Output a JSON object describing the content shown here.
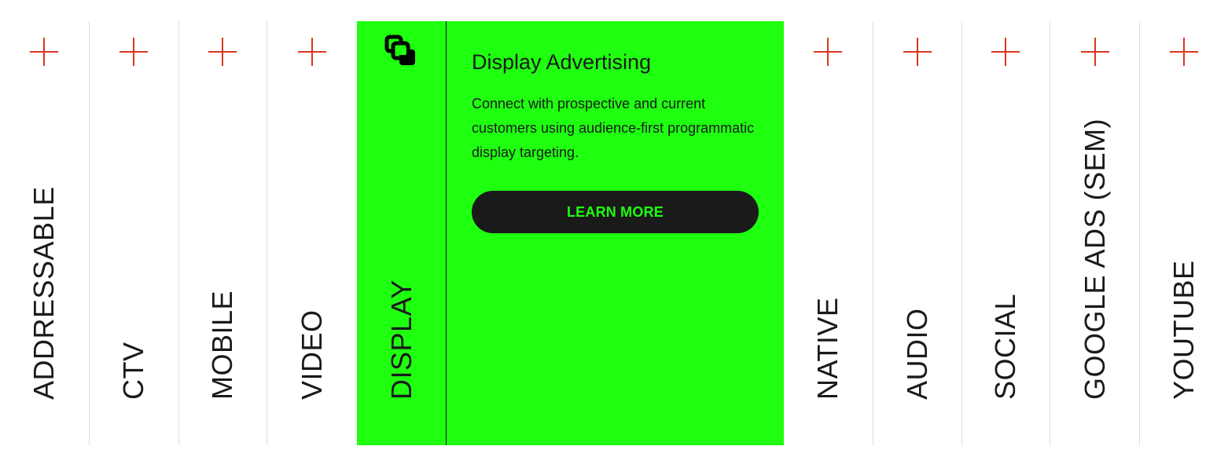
{
  "tabs_before": [
    {
      "label": "ADDRESSABLE",
      "icon": "plus-icon"
    },
    {
      "label": "CTV",
      "icon": "plus-icon"
    },
    {
      "label": "MOBILE",
      "icon": "plus-icon"
    },
    {
      "label": "VIDEO",
      "icon": "plus-icon"
    }
  ],
  "active_tab": {
    "label": "DISPLAY",
    "icon": "display-ad-icon",
    "panel_title": "Display Advertising",
    "panel_description": "Connect with prospective and current customers using audience-first programmatic display targeting.",
    "button_label": "LEARN MORE"
  },
  "tabs_after": [
    {
      "label": "NATIVE",
      "icon": "plus-icon"
    },
    {
      "label": "AUDIO",
      "icon": "plus-icon"
    },
    {
      "label": "SOCIAL",
      "icon": "plus-icon"
    },
    {
      "label": "GOOGLE ADS (SEM)",
      "icon": "plus-icon"
    },
    {
      "label": "YOUTUBE",
      "icon": "plus-icon"
    }
  ],
  "colors": {
    "accent_green": "#1fff10",
    "plus_red": "#d9381e",
    "text_dark": "#1a1a1a",
    "divider": "#dcdcdc"
  }
}
